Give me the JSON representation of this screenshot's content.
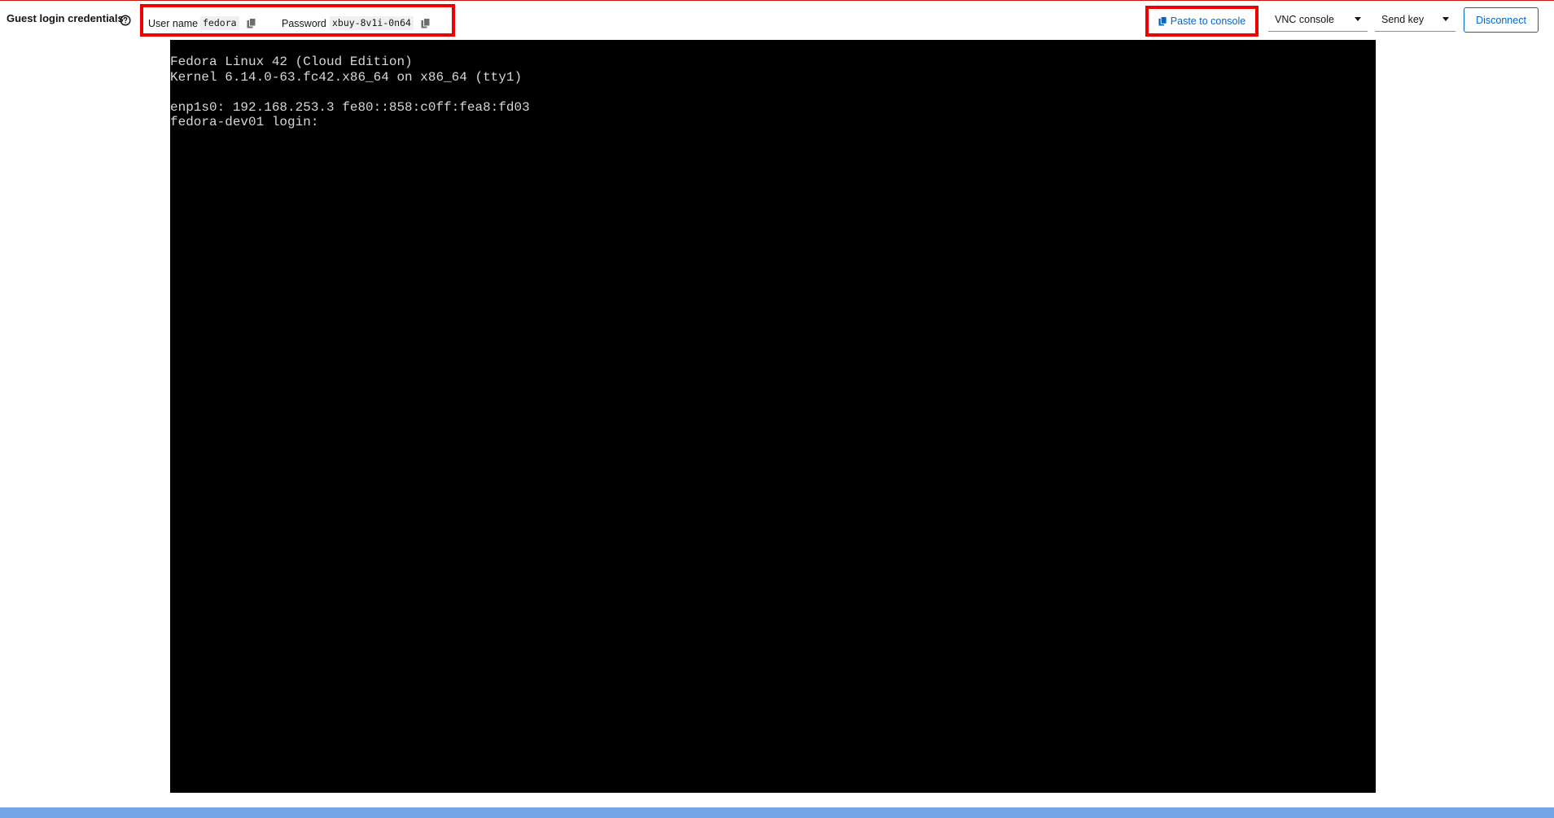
{
  "credentials": {
    "title": "Guest login credentials",
    "help_icon": "question-circle-icon",
    "username_label": "User name",
    "username_value": "fedora",
    "password_label": "Password",
    "password_value": "xbuy-8v1i-0n64",
    "copy_icon": "copy-icon"
  },
  "toolbar": {
    "paste_label": "Paste to console",
    "paste_icon": "copy-icon",
    "console_type": "VNC console",
    "send_key": "Send key",
    "disconnect": "Disconnect"
  },
  "console": {
    "lines": [
      "Fedora Linux 42 (Cloud Edition)",
      "Kernel 6.14.0-63.fc42.x86_64 on x86_64 (tty1)",
      "",
      "enp1s0: 192.168.253.3 fe80::858:c0ff:fea8:fd03",
      "fedora-dev01 login:"
    ]
  },
  "colors": {
    "link_blue": "#0066cc",
    "highlight_red": "#ee0000",
    "console_bg": "#000000",
    "bottom_bar": "#73a5e8"
  }
}
